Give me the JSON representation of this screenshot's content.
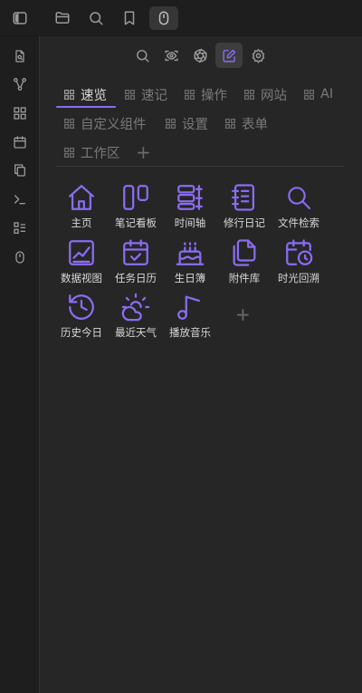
{
  "colors": {
    "accent": "#8a6cf0",
    "icon_gray": "#9a9a9a",
    "text": "#d8d8d8",
    "muted": "#7a7a7a"
  },
  "topbar": {
    "buttons": [
      {
        "icon": "sidebar-toggle-icon"
      },
      {
        "icon": "folder-icon"
      },
      {
        "icon": "search-icon"
      },
      {
        "icon": "bookmark-icon"
      },
      {
        "icon": "mouse-icon",
        "active": true
      }
    ]
  },
  "sidebar": {
    "items": [
      {
        "icon": "file-search-icon"
      },
      {
        "icon": "graph-icon"
      },
      {
        "icon": "grid-icon"
      },
      {
        "icon": "calendar-icon"
      },
      {
        "icon": "copy-icon"
      },
      {
        "icon": "terminal-icon"
      },
      {
        "icon": "checklist-icon"
      },
      {
        "icon": "mouse-icon"
      }
    ]
  },
  "view_toolbar": {
    "buttons": [
      {
        "icon": "search-icon"
      },
      {
        "icon": "scan-eye-icon"
      },
      {
        "icon": "aperture-icon"
      },
      {
        "icon": "edit-icon",
        "active": true
      },
      {
        "icon": "gear-icon"
      }
    ]
  },
  "tabs": [
    {
      "label": "速览",
      "active": true
    },
    {
      "label": "速记"
    },
    {
      "label": "操作"
    },
    {
      "label": "网站"
    },
    {
      "label": "AI"
    },
    {
      "label": "自定义组件"
    },
    {
      "label": "设置"
    },
    {
      "label": "表单"
    },
    {
      "label": "工作区"
    }
  ],
  "add_tab_label": "+",
  "tools": [
    {
      "label": "主页",
      "icon": "home-icon"
    },
    {
      "label": "笔记看板",
      "icon": "kanban-icon"
    },
    {
      "label": "时间轴",
      "icon": "timeline-icon"
    },
    {
      "label": "修行日记",
      "icon": "notebook-icon"
    },
    {
      "label": "文件检索",
      "icon": "search-icon"
    },
    {
      "label": "数据视图",
      "icon": "line-chart-icon"
    },
    {
      "label": "任务日历",
      "icon": "calendar-check-icon"
    },
    {
      "label": "生日簿",
      "icon": "cake-icon"
    },
    {
      "label": "附件库",
      "icon": "files-icon"
    },
    {
      "label": "时光回溯",
      "icon": "calendar-clock-icon"
    },
    {
      "label": "历史今日",
      "icon": "history-icon"
    },
    {
      "label": "最近天气",
      "icon": "cloud-sun-icon"
    },
    {
      "label": "播放音乐",
      "icon": "music-icon"
    }
  ],
  "add_tool_label": "+"
}
